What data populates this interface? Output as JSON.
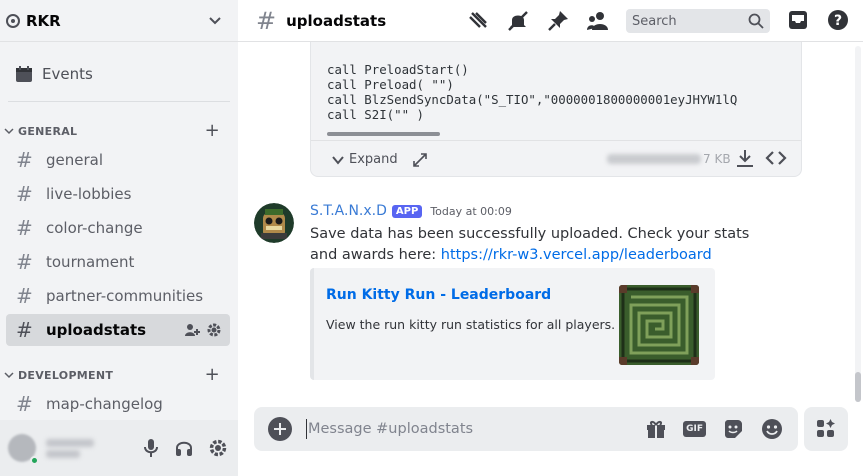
{
  "server": {
    "name": "RKR"
  },
  "sidebar": {
    "events_label": "Events",
    "categories": [
      {
        "label": "GENERAL",
        "channels": [
          "general",
          "live-lobbies",
          "color-change",
          "tournament",
          "partner-communities",
          "uploadstats"
        ]
      },
      {
        "label": "DEVELOPMENT",
        "channels": [
          "map-changelog"
        ]
      }
    ],
    "active_channel": "uploadstats"
  },
  "header": {
    "channel_name": "uploadstats",
    "search_placeholder": "Search"
  },
  "code_attachment": {
    "lines": [
      "call PreloadStart()",
      "call Preload( \"\")",
      "call BlzSendSyncData(\"S_TIO\",\"0000001800000001eyJHYW1lQ",
      "call S2I(\"\" )"
    ],
    "expand_label": "Expand",
    "file_size": "7 KB"
  },
  "message": {
    "author": "S.T.A.N.x.D",
    "tag": "APP",
    "timestamp": "Today at 00:09",
    "text": "Save data has been successfully uploaded. Check your stats and awards here: ",
    "link": "https://rkr-w3.vercel.app/leaderboard",
    "embed": {
      "title": "Run Kitty Run - Leaderboard",
      "description": "View the run kitty run statistics for all players."
    }
  },
  "composer": {
    "placeholder": "Message #uploadstats",
    "gif_label": "GIF"
  },
  "colors": {
    "accent": "#5865f2",
    "link": "#006ce7",
    "status_online": "#23a55a",
    "bot_name": "#3a7bd5"
  },
  "icons": [
    "server-icon",
    "chevron-down-icon",
    "calendar-icon",
    "hash-icon",
    "threads-icon",
    "mute-icon",
    "pin-icon",
    "members-icon",
    "search-icon",
    "inbox-icon",
    "help-icon",
    "invite-icon",
    "settings-icon",
    "mic-icon",
    "headphones-icon",
    "add-icon",
    "gift-icon",
    "sticker-icon",
    "emoji-icon",
    "apps-icon",
    "download-icon",
    "code-icon",
    "external-icon"
  ]
}
